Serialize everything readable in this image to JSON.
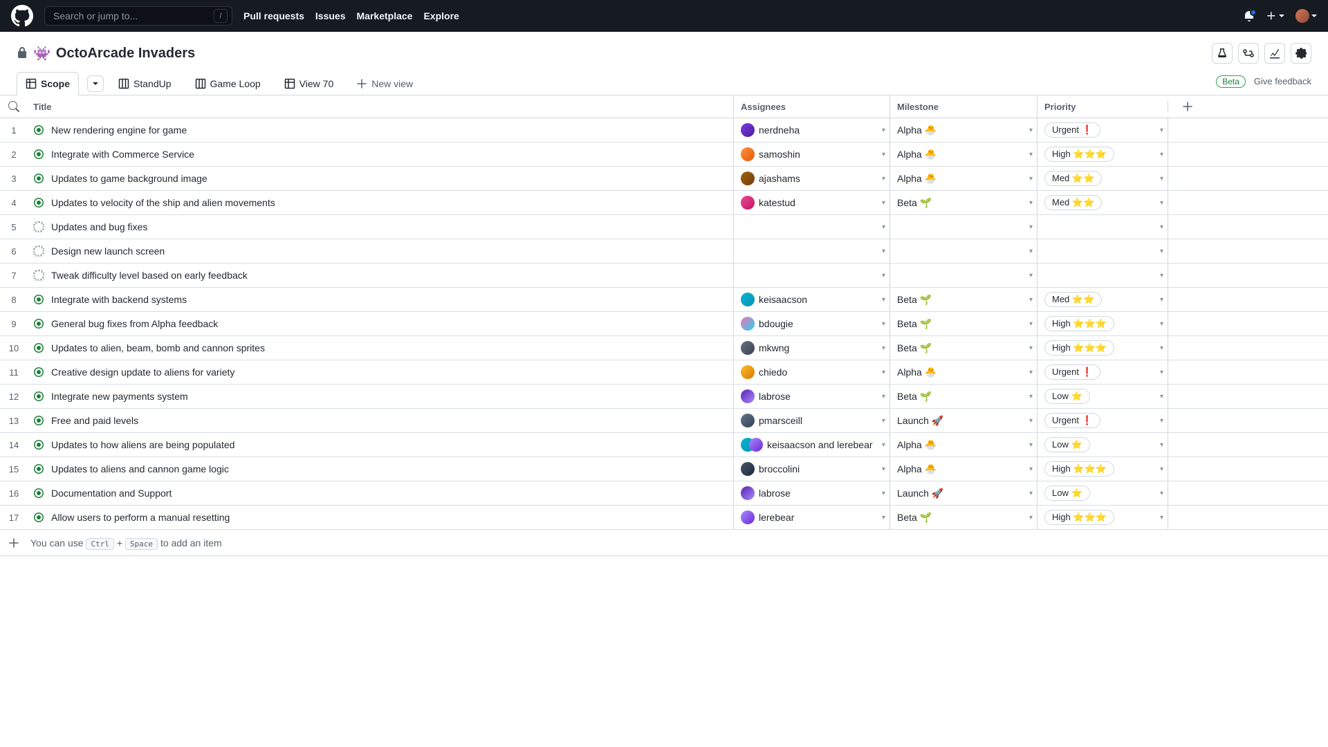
{
  "header": {
    "search_placeholder": "Search or jump to...",
    "slash_key": "/",
    "nav": [
      "Pull requests",
      "Issues",
      "Marketplace",
      "Explore"
    ]
  },
  "project": {
    "emoji": "👾",
    "title": "OctoArcade Invaders"
  },
  "tabs": {
    "items": [
      {
        "label": "Scope",
        "icon": "table"
      },
      {
        "label": "StandUp",
        "icon": "board"
      },
      {
        "label": "Game Loop",
        "icon": "board"
      },
      {
        "label": "View 70",
        "icon": "table"
      }
    ],
    "new_view": "New view",
    "beta": "Beta",
    "feedback": "Give feedback"
  },
  "columns": {
    "title": "Title",
    "assignees": "Assignees",
    "milestone": "Milestone",
    "priority": "Priority"
  },
  "milestones": {
    "alpha": "Alpha 🐣",
    "beta": "Beta 🌱",
    "launch": "Launch 🚀"
  },
  "priorities": {
    "urgent": "Urgent ❗",
    "high": "High ⭐⭐⭐",
    "med": "Med ⭐⭐",
    "low": "Low ⭐"
  },
  "rows": [
    {
      "n": "1",
      "status": "open",
      "title": "New rendering engine for game",
      "assignee": "nerdneha",
      "av": "av-1",
      "milestone": "alpha",
      "priority": "urgent"
    },
    {
      "n": "2",
      "status": "open",
      "title": "Integrate with Commerce Service",
      "assignee": "samoshin",
      "av": "av-2",
      "milestone": "alpha",
      "priority": "high"
    },
    {
      "n": "3",
      "status": "open",
      "title": "Updates to game background image",
      "assignee": "ajashams",
      "av": "av-3",
      "milestone": "alpha",
      "priority": "med"
    },
    {
      "n": "4",
      "status": "open",
      "title": "Updates to velocity of the ship and alien movements",
      "assignee": "katestud",
      "av": "av-4",
      "milestone": "beta",
      "priority": "med"
    },
    {
      "n": "5",
      "status": "draft",
      "title": "Updates and bug fixes"
    },
    {
      "n": "6",
      "status": "draft",
      "title": "Design new launch screen"
    },
    {
      "n": "7",
      "status": "draft",
      "title": "Tweak difficulty level based on early feedback"
    },
    {
      "n": "8",
      "status": "open",
      "title": "Integrate with backend systems",
      "assignee": "keisaacson",
      "av": "av-5",
      "milestone": "beta",
      "priority": "med"
    },
    {
      "n": "9",
      "status": "open",
      "title": "General bug fixes from Alpha feedback",
      "assignee": "bdougie",
      "av": "av-6",
      "milestone": "beta",
      "priority": "high"
    },
    {
      "n": "10",
      "status": "open",
      "title": "Updates to alien, beam, bomb and cannon sprites",
      "assignee": "mkwng",
      "av": "av-7",
      "milestone": "beta",
      "priority": "high"
    },
    {
      "n": "11",
      "status": "open",
      "title": "Creative design update to aliens for variety",
      "assignee": "chiedo",
      "av": "av-8",
      "milestone": "alpha",
      "priority": "urgent"
    },
    {
      "n": "12",
      "status": "open",
      "title": "Integrate new payments system",
      "assignee": "labrose",
      "av": "av-9",
      "milestone": "beta",
      "priority": "low"
    },
    {
      "n": "13",
      "status": "open",
      "title": "Free and paid levels",
      "assignee": "pmarsceill",
      "av": "av-10",
      "milestone": "launch",
      "priority": "urgent"
    },
    {
      "n": "14",
      "status": "open",
      "title": "Updates to how aliens are being populated",
      "assignee": "keisaacson and lerebear",
      "av": "av-5",
      "av2": "av-12",
      "multi": true,
      "milestone": "alpha",
      "priority": "low"
    },
    {
      "n": "15",
      "status": "open",
      "title": "Updates to aliens and cannon game logic",
      "assignee": "broccolini",
      "av": "av-11",
      "milestone": "alpha",
      "priority": "high"
    },
    {
      "n": "16",
      "status": "open",
      "title": "Documentation and Support",
      "assignee": "labrose",
      "av": "av-9",
      "milestone": "launch",
      "priority": "low"
    },
    {
      "n": "17",
      "status": "open",
      "title": "Allow users to perform a manual resetting",
      "assignee": "lerebear",
      "av": "av-12",
      "milestone": "beta",
      "priority": "high"
    }
  ],
  "omnibar": {
    "prefix": "You can use",
    "ctrl": "Ctrl",
    "plus": "+",
    "space": "Space",
    "suffix": "to add an item"
  }
}
